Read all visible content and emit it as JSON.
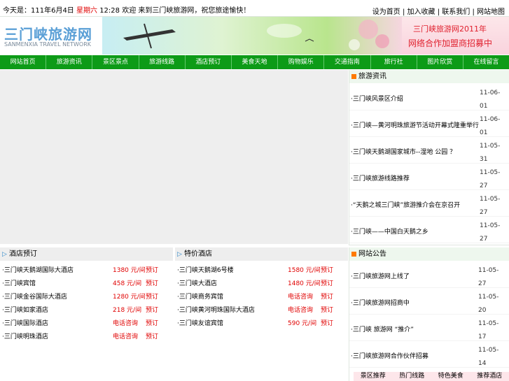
{
  "top_bar": {
    "date_prefix": "今天是：",
    "date": "111年6月4日",
    "weekday": "星期六",
    "time": "12:28",
    "welcome": "欢迎 来到三门峡旅游网，祝您旅途愉快！",
    "links": [
      "设为首页",
      "加入收藏",
      "联系我们",
      "网站地图"
    ]
  },
  "banner": {
    "logo_cn": "三门峡旅游网",
    "logo_en": "SANMENXIA TRAVEL NETWORK",
    "ad_line1": "三门峡旅游网2011年",
    "ad_line2": "网络合作加盟商招募中"
  },
  "nav": {
    "items": [
      "网站首页",
      "旅游资讯",
      "景区景点",
      "旅游线路",
      "酒店预订",
      "美食天地",
      "购物娱乐",
      "交通指南",
      "旅行社",
      "图片欣赏",
      "在线留言"
    ]
  },
  "news": {
    "title": "旅游资讯",
    "items": [
      {
        "title": "·三门峡风景区介绍",
        "date": "11-06-01"
      },
      {
        "title": "·三门峡—黄河明珠旅游节活动开幕式隆重举行",
        "date": "11-06-01"
      },
      {
        "title": "·三门峡天鹅湖国家城市--湿地 公园 ？",
        "date": "11-05-31"
      },
      {
        "title": "·三门峡旅游线路推荐",
        "date": "11-05-27"
      },
      {
        "title": "·“天鹅之城三门峡”旅游推介会在京召开",
        "date": "11-05-27"
      },
      {
        "title": "·三门峡——中国白天鹅之乡",
        "date": "11-05-27"
      }
    ]
  },
  "hotels": {
    "left_title": "酒店预订",
    "right_title": "特价酒店",
    "left": [
      {
        "name": "·三门峡天鹅湖国际大酒店",
        "price": "1380 元/间",
        "book": "预订"
      },
      {
        "name": "·三门峡宾馆",
        "price": "458 元/间",
        "book": "预订"
      },
      {
        "name": "·三门峡金谷国际大酒店",
        "price": "1280 元/间",
        "book": "预订"
      },
      {
        "name": "·三门峡如家酒店",
        "price": "218 元/间",
        "book": "预订"
      },
      {
        "name": "·三门峡国际酒店",
        "price": "电话咨询",
        "book": "预订"
      },
      {
        "name": "·三门峡明珠酒店",
        "price": "电话咨询",
        "book": "预订"
      }
    ],
    "right": [
      {
        "name": "·三门峡天鹅湖6号楼",
        "price": "1580 元/间",
        "book": "预订"
      },
      {
        "name": "·三门峡大酒店",
        "price": "1480 元/间",
        "book": "预订"
      },
      {
        "name": "·三门峡商务宾馆",
        "price": "电话咨询",
        "book": "预订"
      },
      {
        "name": "·三门峡黄河明珠国际大酒店",
        "price": "电话咨询",
        "book": "预订"
      },
      {
        "name": "·三门峡友谊宾馆",
        "price": "590 元/间",
        "book": "预订"
      }
    ]
  },
  "notice": {
    "title": "网站公告",
    "items": [
      {
        "title": "·三门峡旅游网上线了",
        "date": "11-05-27"
      },
      {
        "title": "·三门峡旅游网招商中",
        "date": "11-05-20"
      },
      {
        "title": "·三门峡 旅游网 “推介”",
        "date": "11-05-17"
      },
      {
        "title": "·三门峡旅游网合作伙伴招募",
        "date": "11-05-14"
      }
    ]
  },
  "bottom_tabs": [
    "景区推荐",
    "热门线路",
    "特色美食",
    "推荐酒店"
  ],
  "colors": {
    "nav_green": "#0d9b17",
    "price_red": "#e00000",
    "accent_orange": "#ff7a00"
  }
}
